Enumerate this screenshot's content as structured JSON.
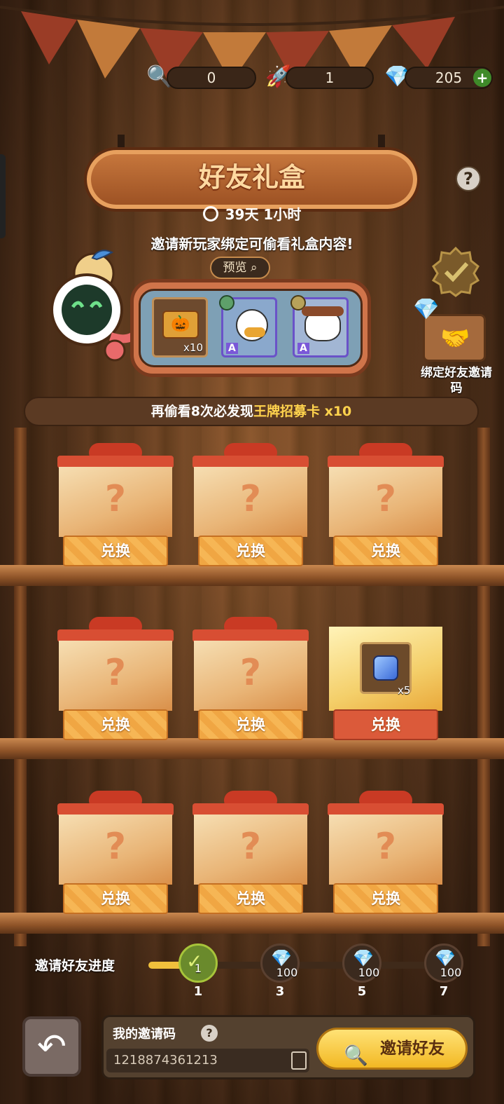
{
  "currency": {
    "magnifier": {
      "icon": "magnifier-icon",
      "value": "0"
    },
    "rocket": {
      "icon": "rocket-icon",
      "value": "1"
    },
    "diamond": {
      "icon": "diamond-icon",
      "value": "205",
      "add_icon": "plus-icon"
    }
  },
  "header": {
    "title": "好友礼盒",
    "help": "?",
    "timer": "39天 1小时",
    "notice": "邀请新玩家绑定可偷看礼盒内容!"
  },
  "preview": {
    "label": "预览",
    "items": [
      {
        "icon": "pumpkin-ticket-icon",
        "count": "x10"
      },
      {
        "icon": "duck-hero-card-icon",
        "badge": "A"
      },
      {
        "icon": "dog-hero-card-icon",
        "badge": "A"
      }
    ]
  },
  "side": {
    "bind_label": "绑定好友邀请码"
  },
  "banner": {
    "prefix": "再偷看8次必发现",
    "highlight": "王牌招募卡",
    "suffix": " x10"
  },
  "boxes": {
    "redeem_label": "兑换",
    "unknown_mark": "?",
    "special_count": "x5"
  },
  "progress": {
    "label": "邀请好友进度",
    "fill_fraction": 0.12,
    "nodes": [
      {
        "value": "1",
        "number": "1",
        "done": true
      },
      {
        "value": "100",
        "number": "3",
        "done": false
      },
      {
        "value": "100",
        "number": "5",
        "done": false
      },
      {
        "value": "100",
        "number": "7",
        "done": false
      }
    ]
  },
  "bottom": {
    "code_label": "我的邀请码",
    "help": "?",
    "code_value": "1218874361213",
    "invite_label": "邀请好友"
  },
  "colors": {
    "accent": "#f2b823",
    "banner_highlight": "#ffd34d",
    "redeem_active": "#db5a3a"
  }
}
